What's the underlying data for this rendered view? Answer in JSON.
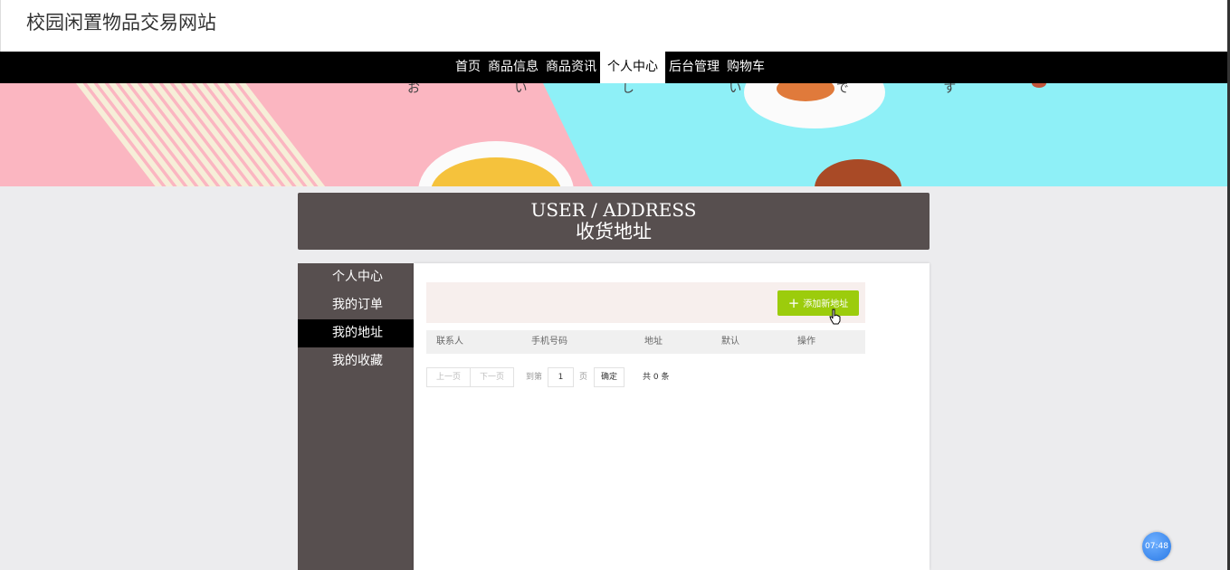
{
  "site": {
    "title": "校园闲置物品交易网站"
  },
  "nav": {
    "items": [
      {
        "label": "首页"
      },
      {
        "label": "商品信息"
      },
      {
        "label": "商品资讯"
      },
      {
        "label": "个人中心",
        "active": true
      },
      {
        "label": "后台管理"
      },
      {
        "label": "购物车"
      }
    ]
  },
  "banner": {
    "text": "お い し い で す"
  },
  "page_head": {
    "en": "USER / ADDRESS",
    "cn": "收货地址"
  },
  "sidebar": {
    "items": [
      {
        "label": "个人中心"
      },
      {
        "label": "我的订单"
      },
      {
        "label": "我的地址",
        "active": true
      },
      {
        "label": "我的收藏"
      }
    ]
  },
  "content": {
    "add_button": "添加新地址",
    "columns": [
      "联系人",
      "手机号码",
      "地址",
      "默认",
      "操作"
    ],
    "rows": []
  },
  "pager": {
    "prev": "上一页",
    "next": "下一页",
    "goto_label": "到第",
    "page_value": "1",
    "page_unit": "页",
    "confirm": "确定",
    "total": "共 0 条"
  },
  "clock": {
    "time": "07:48"
  },
  "colors": {
    "nav_bg": "#000000",
    "panel_bg": "#574f4f",
    "accent": "#9ccc0c"
  }
}
